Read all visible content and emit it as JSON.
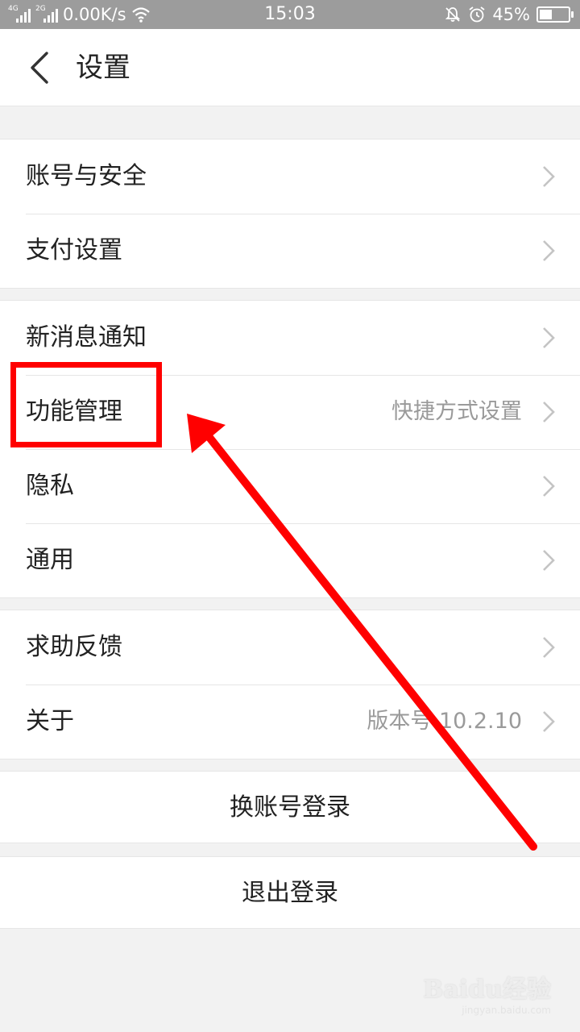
{
  "status_bar": {
    "net1": "4G",
    "net2": "2G",
    "speed": "0.00K/s",
    "time": "15:03",
    "battery": "45%",
    "battery_level": 0.45,
    "icons": [
      "signal-icon",
      "wifi-icon",
      "mute-icon",
      "alarm-icon",
      "battery-icon"
    ]
  },
  "header": {
    "back_icon": "chevron-left-icon",
    "title": "设置"
  },
  "groups": [
    {
      "items": [
        {
          "label": "账号与安全",
          "value": ""
        },
        {
          "label": "支付设置",
          "value": ""
        }
      ]
    },
    {
      "items": [
        {
          "label": "新消息通知",
          "value": ""
        },
        {
          "label": "功能管理",
          "value": "快捷方式设置"
        },
        {
          "label": "隐私",
          "value": ""
        },
        {
          "label": "通用",
          "value": ""
        }
      ]
    },
    {
      "items": [
        {
          "label": "求助反馈",
          "value": ""
        },
        {
          "label": "关于",
          "value": "版本号 10.2.10"
        }
      ]
    }
  ],
  "actions": {
    "switch_account": "换账号登录",
    "logout": "退出登录"
  },
  "annotation": {
    "color": "#ff0000"
  },
  "watermark": {
    "brand": "Baidu经验",
    "url": "jingyan.baidu.com"
  }
}
